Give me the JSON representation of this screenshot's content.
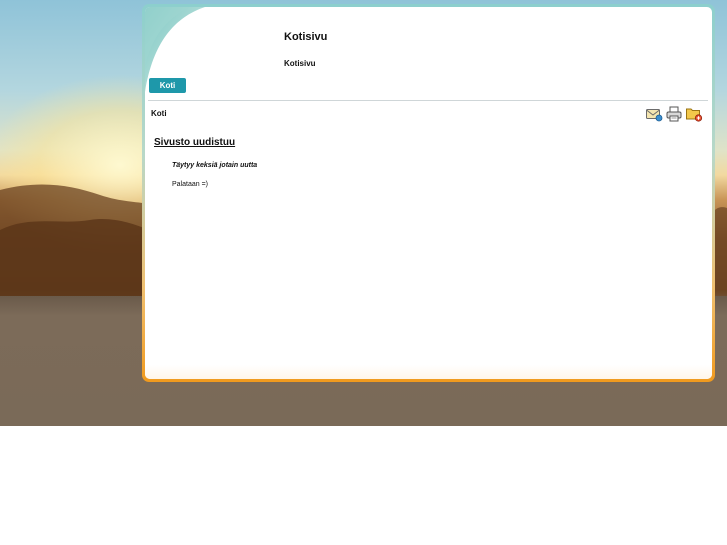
{
  "header": {
    "title": "Kotisivu",
    "subtitle": "Kotisivu"
  },
  "nav": {
    "tabs": [
      {
        "label": "Koti"
      }
    ]
  },
  "breadcrumb": "Koti",
  "toolbar": {
    "icons": [
      "email-icon",
      "print-icon",
      "bookmark-folder-icon"
    ]
  },
  "article": {
    "title": "Sivusto uudistuu",
    "lead": "Täytyy keksiä jotain uutta",
    "body": "Palataan =)"
  },
  "colors": {
    "tab": "#1e98aa",
    "border_top": "#8ccfcd",
    "border_bottom": "#f09a1e"
  }
}
